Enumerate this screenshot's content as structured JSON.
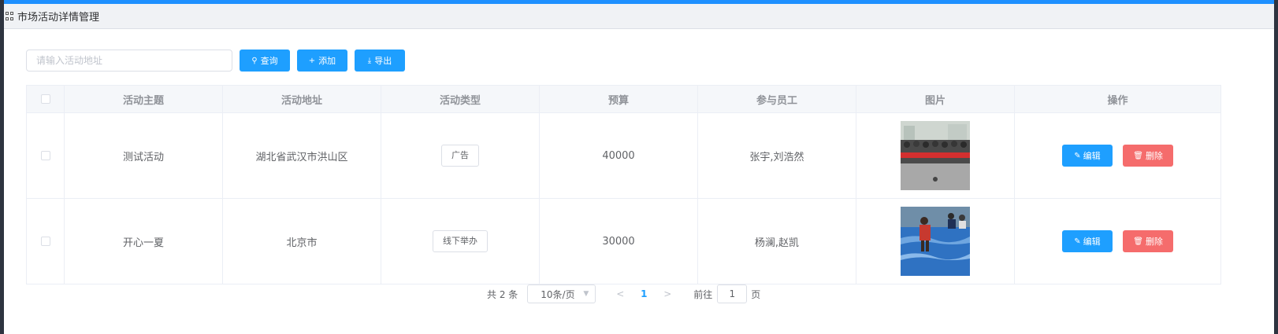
{
  "header": {
    "title": "市场活动详情管理"
  },
  "toolbar": {
    "search_placeholder": "请输入活动地址",
    "query_label": "查询",
    "add_label": "添加",
    "export_label": "导出"
  },
  "table": {
    "columns": [
      "活动主题",
      "活动地址",
      "活动类型",
      "预算",
      "参与员工",
      "图片",
      "操作"
    ],
    "rows": [
      {
        "theme": "测试活动",
        "address": "湖北省武汉市洪山区",
        "type": "广告",
        "budget": "40000",
        "staff": "张宇,刘浩然"
      },
      {
        "theme": "开心一夏",
        "address": "北京市",
        "type": "线下举办",
        "budget": "30000",
        "staff": "杨澜,赵凯"
      }
    ],
    "edit_label": "编辑",
    "delete_label": "删除"
  },
  "pagination": {
    "total": "共 2 条",
    "page_size": "10条/页",
    "current_page": "1",
    "goto_label": "前往",
    "goto_value": "1",
    "unit": "页"
  },
  "colors": {
    "primary": "#1e9fff",
    "danger": "#f56c6c",
    "accent_bar": "#1e90ff"
  }
}
